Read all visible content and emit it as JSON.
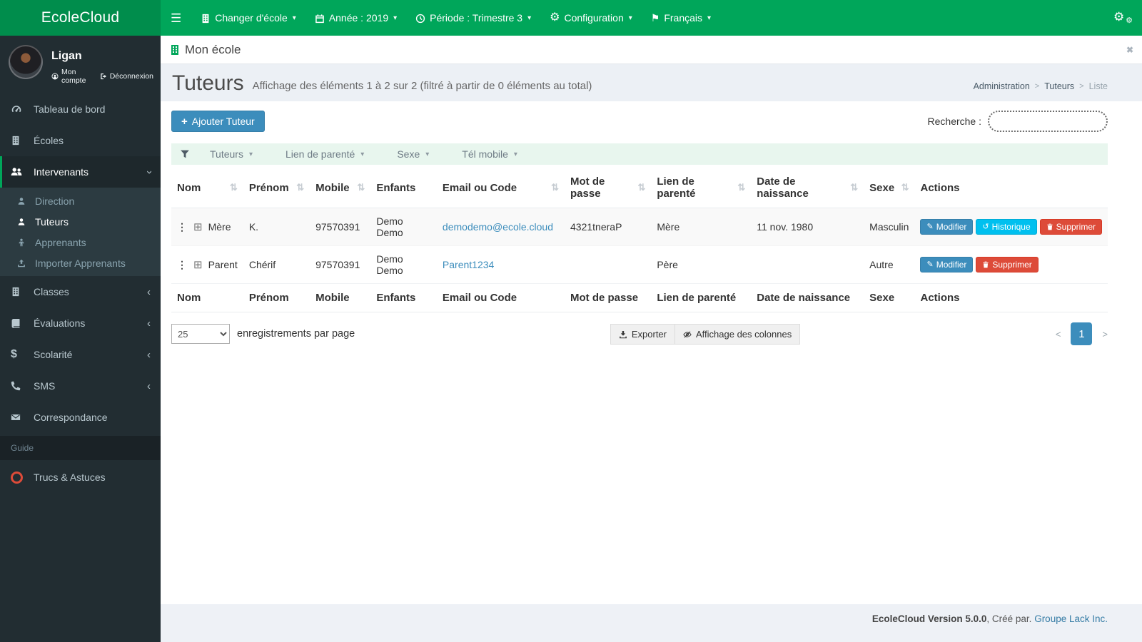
{
  "navbar": {
    "brand": "EcoleCloud",
    "menu": [
      {
        "label": "Changer d'école"
      },
      {
        "label": "Année : 2019"
      },
      {
        "label": "Période : Trimestre 3"
      },
      {
        "label": "Configuration"
      },
      {
        "label": "Français"
      }
    ]
  },
  "sidebar": {
    "user": {
      "name": "Ligan",
      "account": "Mon compte",
      "logout": "Déconnexion"
    },
    "items": [
      {
        "label": "Tableau de bord"
      },
      {
        "label": "Écoles"
      },
      {
        "label": "Intervenants"
      },
      {
        "label": "Classes"
      },
      {
        "label": "Évaluations"
      },
      {
        "label": "Scolarité"
      },
      {
        "label": "SMS"
      },
      {
        "label": "Correspondance"
      }
    ],
    "submenu": [
      {
        "label": "Direction"
      },
      {
        "label": "Tuteurs"
      },
      {
        "label": "Apprenants"
      },
      {
        "label": "Importer Apprenants"
      }
    ],
    "section": "Guide",
    "guide_item": "Trucs & Astuces"
  },
  "contentbar": {
    "title": "Mon école"
  },
  "page": {
    "title": "Tuteurs",
    "subtitle": "Affichage des éléments 1 à 2 sur 2 (filtré à partir de 0 éléments au total)",
    "breadcrumb": [
      "Administration",
      "Tuteurs",
      "Liste"
    ],
    "breadcrumb_sep": ">"
  },
  "toolbar": {
    "add_label": "Ajouter Tuteur",
    "search_label": "Recherche :"
  },
  "filters": {
    "items": [
      "Tuteurs",
      "Lien de parenté",
      "Sexe",
      "Tél mobile"
    ]
  },
  "table": {
    "columns": [
      "Nom",
      "Prénom",
      "Mobile",
      "Enfants",
      "Email ou Code",
      "Mot de passe",
      "Lien de parenté",
      "Date de naissance",
      "Sexe",
      "Actions"
    ],
    "rows": [
      {
        "nom": "Mère",
        "prenom": "K.",
        "mobile": "97570391",
        "enfants": "Demo Demo",
        "email": "demodemo@ecole.cloud",
        "password": "4321tneraP",
        "lien": "Mère",
        "naissance": "11 nov. 1980",
        "sexe": "Masculin"
      },
      {
        "nom": "Parent",
        "prenom": "Chérif",
        "mobile": "97570391",
        "enfants": "Demo Demo",
        "email": "Parent1234",
        "password": "",
        "lien": "Père",
        "naissance": "",
        "sexe": "Autre"
      }
    ],
    "actions": {
      "edit": "Modifier",
      "history": "Historique",
      "delete": "Supprimer"
    }
  },
  "pagination": {
    "page_size": "25",
    "per_page_label": "enregistrements par page",
    "export_label": "Exporter",
    "columns_label": "Affichage des colonnes",
    "prev": "<",
    "page": "1",
    "next": ">"
  },
  "footer": {
    "version": "EcoleCloud Version 5.0.0",
    "sep": ", Créé par. ",
    "company": "Groupe Lack Inc."
  },
  "icons": {
    "hamburger": "☰",
    "caret": "▾",
    "gear": "⚙",
    "flag": "⚑",
    "sort": "⇅",
    "dots": "⋮",
    "plus_square": "⊞",
    "close": "✖",
    "pencil": "✎",
    "history": "↺",
    "chevron": "‹",
    "plus": "+",
    "dollar": "$"
  },
  "colors": {
    "navbar_green": "#00a65a",
    "logo_green": "#008d4c",
    "sidebar_dark": "#222d32",
    "primary_blue": "#3c8dbc",
    "info_cyan": "#00c0ef",
    "danger_red": "#dd4b39",
    "content_bg": "#ecf0f5",
    "filter_bg": "#e8f6ee"
  }
}
